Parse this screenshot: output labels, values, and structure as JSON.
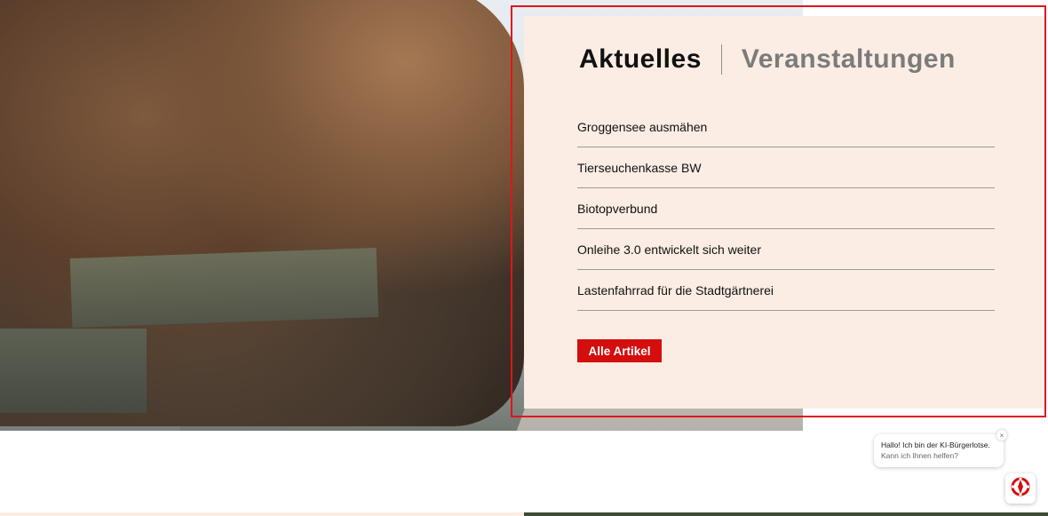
{
  "colors": {
    "panel_bg": "#fbede3",
    "accent_red": "#d40d0d",
    "highlight_border": "#e0141c",
    "text_dark": "#111111",
    "text_muted": "#7b7b7b"
  },
  "news": {
    "tabs": [
      {
        "label": "Aktuelles",
        "active": true
      },
      {
        "label": "Veranstaltungen",
        "active": false
      }
    ],
    "items": [
      {
        "title": "Groggensee ausmähen"
      },
      {
        "title": "Tierseuchenkasse BW"
      },
      {
        "title": "Biotopverbund"
      },
      {
        "title": "Onleihe 3.0 entwickelt sich weiter"
      },
      {
        "title": "Lastenfahrrad für die Stadtgärtnerei"
      }
    ],
    "all_button_label": "Alle Artikel"
  },
  "chat": {
    "line1": "Hallo! Ich bin der KI-Bürgerlotse.",
    "line2": "Kann ich Ihnen helfen?",
    "close_icon": "close-icon",
    "assistant_icon": "assistant-logo-icon"
  }
}
